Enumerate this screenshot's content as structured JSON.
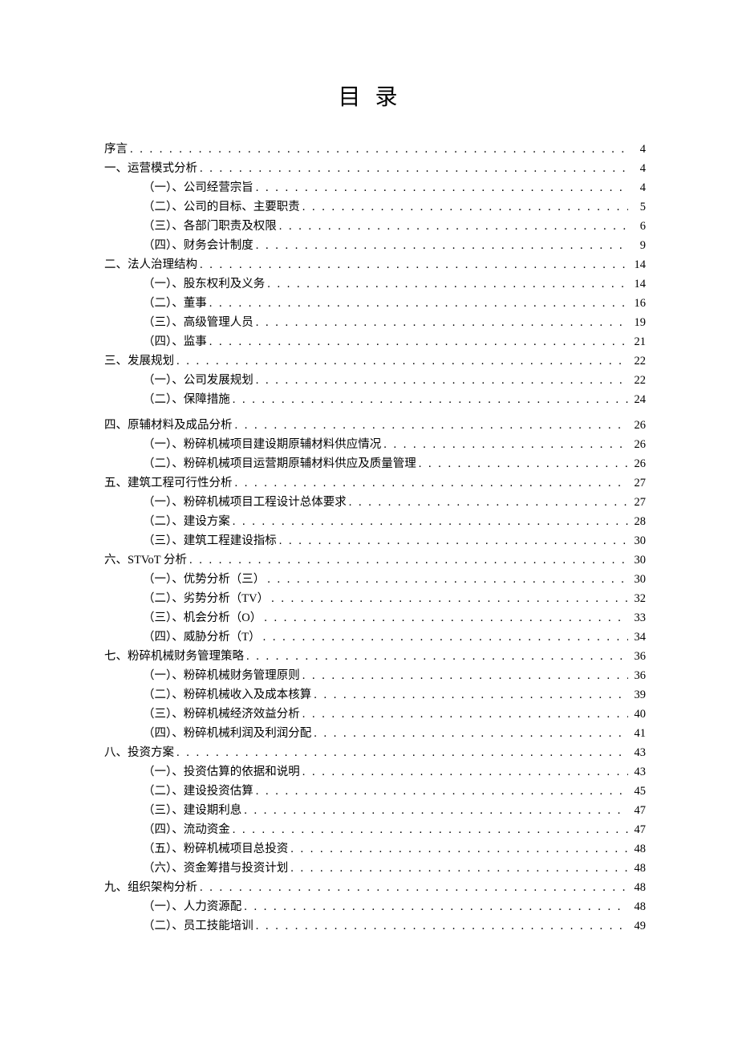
{
  "title": "目录",
  "entries": [
    {
      "level": 1,
      "label": "序言",
      "page": "4"
    },
    {
      "level": 1,
      "label": "一、运营模式分析",
      "page": "4"
    },
    {
      "level": 2,
      "label": "（一）、公司经营宗旨",
      "page": "4"
    },
    {
      "level": 2,
      "label": "（二）、公司的目标、主要职责",
      "page": "5"
    },
    {
      "level": 2,
      "label": "（三）、各部门职责及权限",
      "page": "6"
    },
    {
      "level": 2,
      "label": "（四）、财务会计制度",
      "page": "9"
    },
    {
      "level": 1,
      "label": "二、法人治理结构",
      "page": "14"
    },
    {
      "level": 2,
      "label": "（一）、股东权利及义务",
      "page": "14"
    },
    {
      "level": 2,
      "label": "（二）、董事",
      "page": "16"
    },
    {
      "level": 2,
      "label": "（三）、高级管理人员",
      "page": "19"
    },
    {
      "level": 2,
      "label": "（四）、监事",
      "page": "21"
    },
    {
      "level": 1,
      "label": "三、发展规划",
      "page": "22"
    },
    {
      "level": 2,
      "label": "（一）、公司发展规划",
      "page": "22"
    },
    {
      "level": 2,
      "label": "（二）、保障措施",
      "page": "24"
    },
    {
      "level": 1,
      "label": "四、原辅材料及成品分析",
      "page": "26",
      "gap": true
    },
    {
      "level": 2,
      "label": "（一）、粉碎机械项目建设期原辅材料供应情况",
      "page": "26"
    },
    {
      "level": 2,
      "label": "（二）、粉碎机械项目运营期原辅材料供应及质量管理",
      "page": "26"
    },
    {
      "level": 1,
      "label": "五、建筑工程可行性分析",
      "page": "27"
    },
    {
      "level": 2,
      "label": "（一）、粉碎机械项目工程设计总体要求",
      "page": "27"
    },
    {
      "level": 2,
      "label": "（二）、建设方案",
      "page": "28"
    },
    {
      "level": 2,
      "label": "（三）、建筑工程建设指标",
      "page": "30"
    },
    {
      "level": 1,
      "label": "六、STVoT 分析",
      "page": "30"
    },
    {
      "level": 2,
      "label": "（一）、优势分析（三）",
      "page": "30"
    },
    {
      "level": 2,
      "label": "（二）、劣势分析（TV）",
      "page": "32"
    },
    {
      "level": 2,
      "label": "（三）、机会分析（O）",
      "page": "33"
    },
    {
      "level": 2,
      "label": "（四）、威胁分析（T）",
      "page": "34"
    },
    {
      "level": 1,
      "label": "七、粉碎机械财务管理策略",
      "page": "36"
    },
    {
      "level": 2,
      "label": "（一）、粉碎机械财务管理原则",
      "page": "36"
    },
    {
      "level": 2,
      "label": "（二）、粉碎机械收入及成本核算",
      "page": "39"
    },
    {
      "level": 2,
      "label": "（三）、粉碎机械经济效益分析",
      "page": "40"
    },
    {
      "level": 2,
      "label": "（四）、粉碎机械利润及利润分配",
      "page": "41"
    },
    {
      "level": 1,
      "label": "八、投资方案",
      "page": "43"
    },
    {
      "level": 2,
      "label": "（一）、投资估算的依据和说明",
      "page": "43"
    },
    {
      "level": 2,
      "label": "（二）、建设投资估算",
      "page": "45"
    },
    {
      "level": 2,
      "label": "（三）、建设期利息",
      "page": "47"
    },
    {
      "level": 2,
      "label": "（四）、流动资金",
      "page": "47"
    },
    {
      "level": 2,
      "label": "（五）、粉碎机械项目总投资",
      "page": "48"
    },
    {
      "level": 2,
      "label": "（六）、资金筹措与投资计划",
      "page": "48"
    },
    {
      "level": 1,
      "label": "九、组织架构分析",
      "page": "48"
    },
    {
      "level": 2,
      "label": "（一）、人力资源配",
      "page": "48"
    },
    {
      "level": 2,
      "label": "（二）、员工技能培训",
      "page": "49"
    }
  ]
}
